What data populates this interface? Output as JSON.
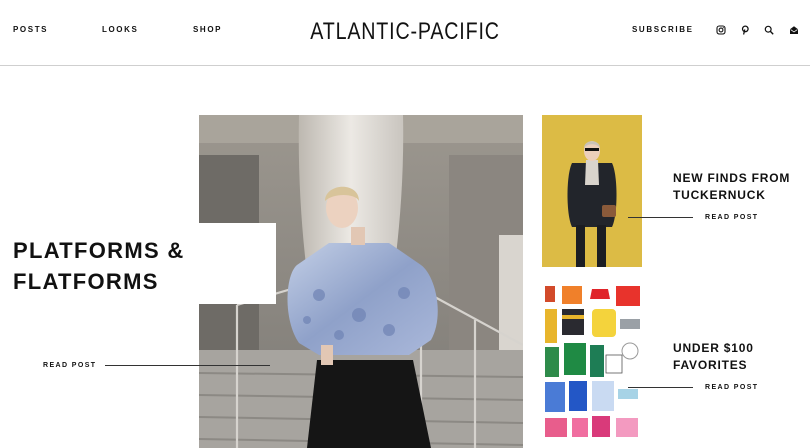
{
  "header": {
    "nav": [
      "POSTS",
      "LOOKS",
      "SHOP"
    ],
    "logo": "ATLANTIC-PACIFIC",
    "subscribe": "SUBSCRIBE",
    "icons": [
      "instagram-icon",
      "pinterest-icon",
      "search-icon",
      "mail-icon"
    ]
  },
  "hero": {
    "title": "PLATFORMS & FLATFORMS",
    "read_label": "READ POST"
  },
  "cards": [
    {
      "title": "NEW FINDS FROM TUCKERNUCK",
      "read_label": "READ POST"
    },
    {
      "title": "UNDER $100 FAVORITES",
      "read_label": "READ POST"
    }
  ],
  "colors": {
    "text": "#111111",
    "divider": "#cfcfcf",
    "hero_top": "#a8a39a",
    "thumb1_bg": "#e2c24a"
  }
}
